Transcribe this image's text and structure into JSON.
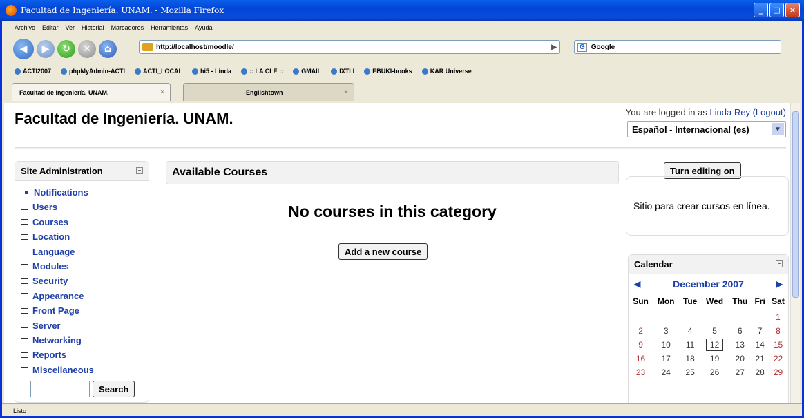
{
  "window": {
    "title": "Facultad de Ingeniería. UNAM. - Mozilla Firefox",
    "status": "Listo"
  },
  "menu": [
    "Archivo",
    "Editar",
    "Ver",
    "Historial",
    "Marcadores",
    "Herramientas",
    "Ayuda"
  ],
  "nav": {
    "url": "http://localhost/moodle/",
    "search_engine": "Google"
  },
  "bookmarks": [
    "ACTI2007",
    "phpMyAdmin-ACTI",
    "ACTI_LOCAL",
    "hi5 - Linda",
    ":: LA CLÉ ::",
    "GMAIL",
    "IXTLI",
    "EBUKI-books",
    "KAR Universe"
  ],
  "tabs": [
    {
      "label": "Facultad de Ingeniería. UNAM."
    },
    {
      "label": "Englishtown"
    }
  ],
  "page": {
    "site_title": "Facultad de Ingeniería. UNAM.",
    "login_prefix": "You are logged in as ",
    "user_name": "Linda Rey",
    "logout": "(Logout)",
    "language": "Español - Internacional (es)",
    "admin": {
      "title": "Site Administration",
      "items": [
        "Notifications",
        "Users",
        "Courses",
        "Location",
        "Language",
        "Modules",
        "Security",
        "Appearance",
        "Front Page",
        "Server",
        "Networking",
        "Reports",
        "Miscellaneous"
      ],
      "search_button": "Search"
    },
    "courses": {
      "title": "Available Courses",
      "empty": "No courses in this category",
      "add_button": "Add a new course"
    },
    "turn_editing": "Turn editing on",
    "site_description": "Sitio para crear cursos en línea.",
    "calendar": {
      "title": "Calendar",
      "month": "December 2007",
      "days": [
        "Sun",
        "Mon",
        "Tue",
        "Wed",
        "Thu",
        "Fri",
        "Sat"
      ],
      "weeks": [
        [
          "",
          "",
          "",
          "",
          "",
          "",
          "1"
        ],
        [
          "2",
          "3",
          "4",
          "5",
          "6",
          "7",
          "8"
        ],
        [
          "9",
          "10",
          "11",
          "12",
          "13",
          "14",
          "15"
        ],
        [
          "16",
          "17",
          "18",
          "19",
          "20",
          "21",
          "22"
        ],
        [
          "23",
          "24",
          "25",
          "26",
          "27",
          "28",
          "29"
        ]
      ],
      "today": "12"
    }
  },
  "colors": {
    "link": "#1E40A8",
    "weekend": "#B03030",
    "titlebar": "#0A4AD7"
  }
}
